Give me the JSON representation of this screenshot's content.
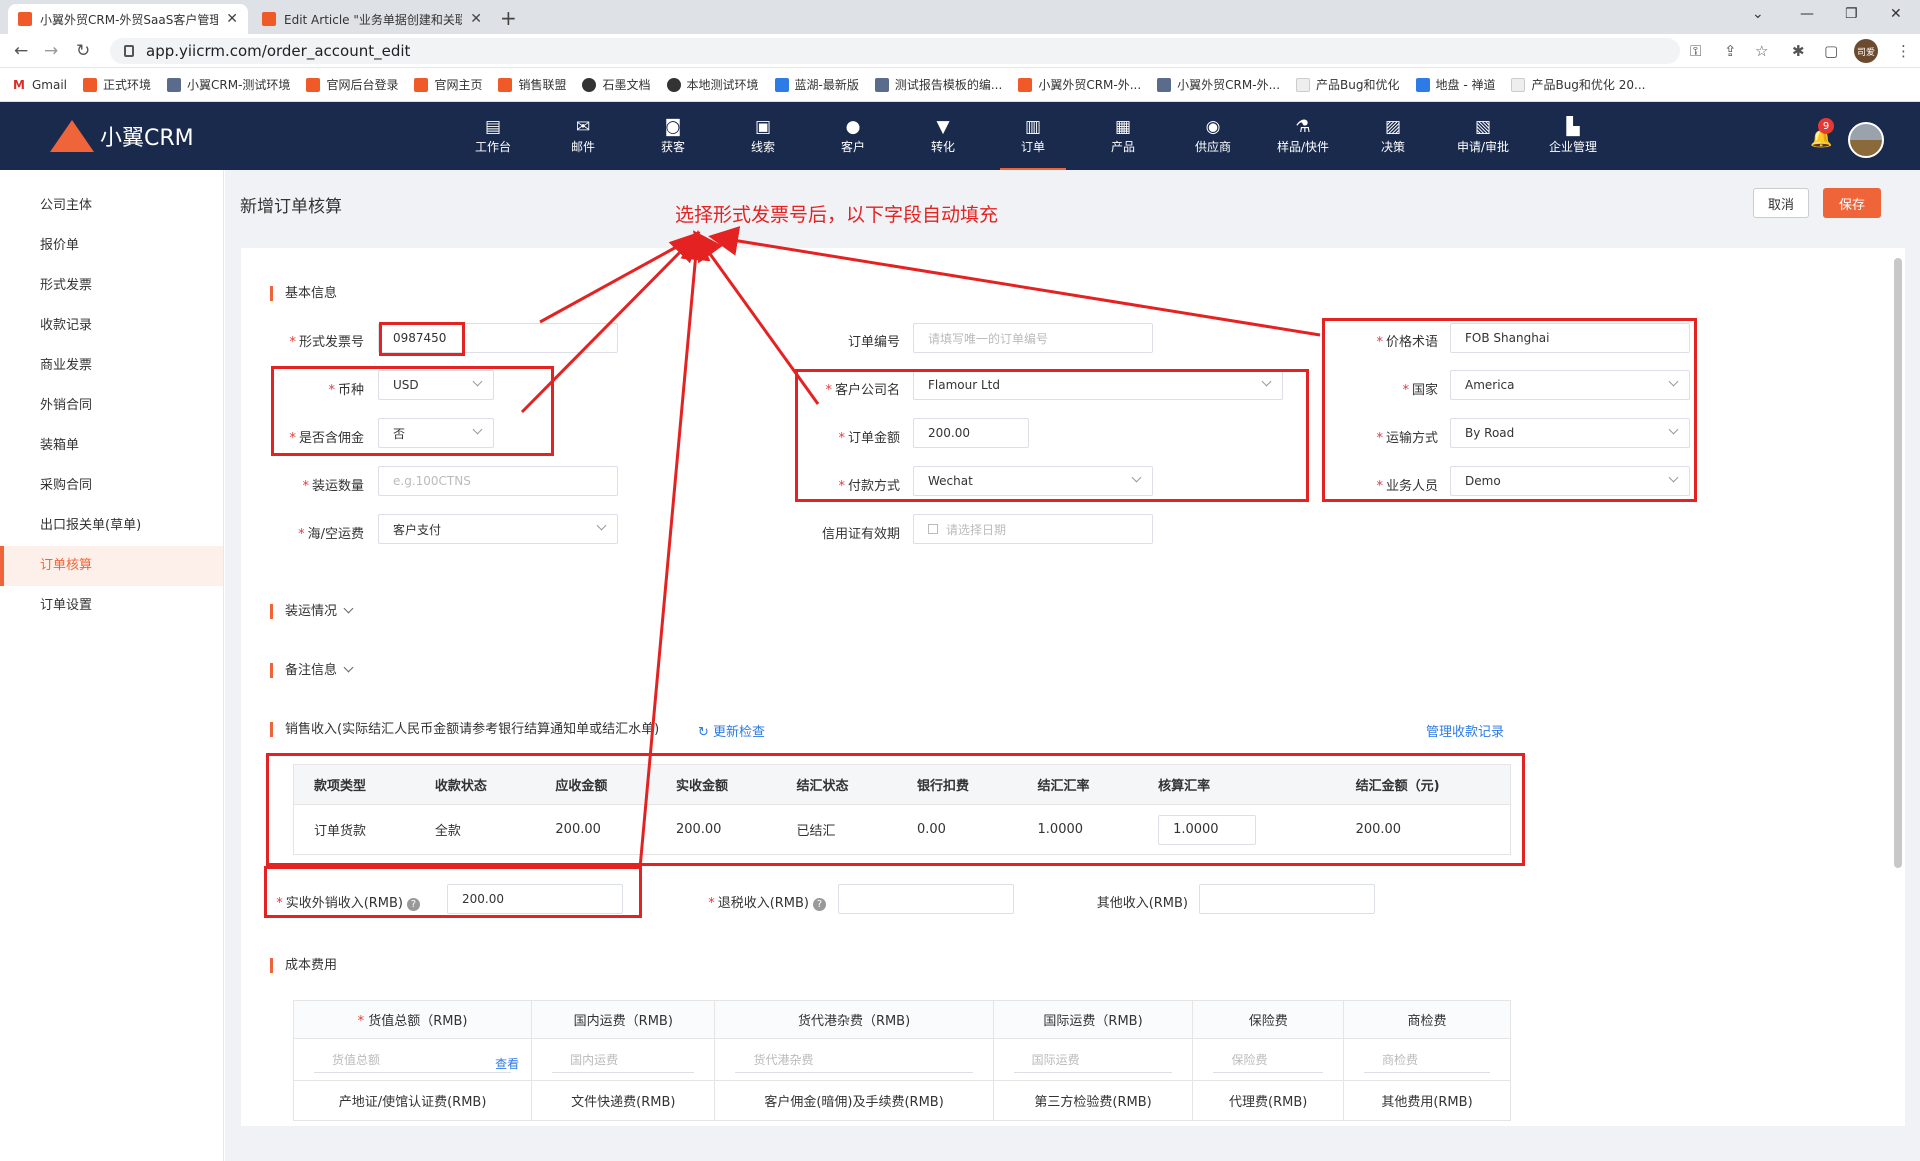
{
  "browser": {
    "tabs": [
      {
        "title": "小翼外贸CRM-外贸SaaS客户管理",
        "active": true
      },
      {
        "title": "Edit Article \"业务单据创建和关联",
        "active": false
      }
    ],
    "url": "app.yiicrm.com/order_account_edit",
    "profile_label": "司爱",
    "bookmarks": [
      "Gmail",
      "正式环境",
      "小翼CRM-测试环境",
      "官网后台登录",
      "官网主页",
      "销售联盟",
      "石墨文档",
      "本地测试环境",
      "蓝湖-最新版",
      "测试报告模板的编...",
      "小翼外贸CRM-外...",
      "小翼外贸CRM-外...",
      "产品Bug和优化",
      "地盘 - 禅道",
      "产品Bug和优化 20..."
    ]
  },
  "app": {
    "logo_text": "小翼CRM",
    "nav": [
      {
        "label": "工作台",
        "icon": "workbench-icon",
        "glyph": "▤"
      },
      {
        "label": "邮件",
        "icon": "mail-icon",
        "glyph": "✉"
      },
      {
        "label": "获客",
        "icon": "acquire-icon",
        "glyph": "◙"
      },
      {
        "label": "线索",
        "icon": "lead-icon",
        "glyph": "▣"
      },
      {
        "label": "客户",
        "icon": "customer-icon",
        "glyph": "●"
      },
      {
        "label": "转化",
        "icon": "funnel-icon",
        "glyph": "▼"
      },
      {
        "label": "订单",
        "icon": "order-icon",
        "glyph": "▥"
      },
      {
        "label": "产品",
        "icon": "product-icon",
        "glyph": "▦"
      },
      {
        "label": "供应商",
        "icon": "supplier-icon",
        "glyph": "◉"
      },
      {
        "label": "样品/快件",
        "icon": "flask-icon",
        "glyph": "⚗"
      },
      {
        "label": "决策",
        "icon": "chart-icon",
        "glyph": "▨"
      },
      {
        "label": "申请/审批",
        "icon": "approval-icon",
        "glyph": "▧"
      },
      {
        "label": "企业管理",
        "icon": "building-icon",
        "glyph": "▙"
      }
    ],
    "active_nav": "订单",
    "notification_count": "9"
  },
  "sidebar": [
    "公司主体",
    "报价单",
    "形式发票",
    "收款记录",
    "商业发票",
    "外销合同",
    "装箱单",
    "采购合同",
    "出口报关单(草单)",
    "订单核算",
    "订单设置"
  ],
  "page": {
    "title": "新增订单核算",
    "cancel": "取消",
    "save": "保存",
    "annotation": "选择形式发票号后，以下字段自动填充"
  },
  "basic": {
    "section": "基本信息",
    "proforma_label": "形式发票号",
    "proforma_value": "0987450",
    "currency_label": "币种",
    "currency_value": "USD",
    "commission_label": "是否含佣金",
    "commission_value": "否",
    "qty_label": "装运数量",
    "qty_placeholder": "e.g.100CTNS",
    "freight_label": "海/空运费",
    "freight_value": "客户支付",
    "orderno_label": "订单编号",
    "orderno_placeholder": "请填写唯一的订单编号",
    "company_label": "客户公司名",
    "company_value": "Flamour Ltd",
    "amount_label": "订单金额",
    "amount_value": "200.00",
    "payment_label": "付款方式",
    "payment_value": "Wechat",
    "lc_label": "信用证有效期",
    "lc_placeholder": "请选择日期",
    "terms_label": "价格术语",
    "terms_value": "FOB Shanghai",
    "country_label": "国家",
    "country_value": "America",
    "transport_label": "运输方式",
    "transport_value": "By Road",
    "sales_label": "业务人员",
    "sales_value": "Demo"
  },
  "shipping_section": "装运情况",
  "remark_section": "备注信息",
  "sales": {
    "section": "销售收入(实际结汇人民币金额请参考银行结算通知单或结汇水单)",
    "refresh": "更新检查",
    "manage": "管理收款记录",
    "headers": [
      "款项类型",
      "收款状态",
      "应收金额",
      "实收金额",
      "结汇状态",
      "银行扣费",
      "结汇汇率",
      "核算汇率",
      "结汇金额（元)"
    ],
    "row": [
      "订单货款",
      "全款",
      "200.00",
      "200.00",
      "已结汇",
      "0.00",
      "1.0000",
      "1.0000",
      "200.00"
    ],
    "actual_label": "实收外销收入(RMB)",
    "actual_value": "200.00",
    "tax_label": "退税收入(RMB)",
    "other_label": "其他收入(RMB)"
  },
  "cost": {
    "section": "成本费用",
    "headers1": [
      "货值总额（RMB)",
      "国内运费（RMB)",
      "货代港杂费（RMB)",
      "国际运费（RMB)",
      "保险费",
      "商检费"
    ],
    "placeholders": [
      "货值总额",
      "国内运费",
      "货代港杂费",
      "国际运费",
      "保险费",
      "商检费"
    ],
    "view": "查看",
    "headers2": [
      "产地证/使馆认证费(RMB)",
      "文件快递费(RMB)",
      "客户佣金(暗佣)及手续费(RMB)",
      "第三方检验费(RMB)",
      "代理费(RMB)",
      "其他费用(RMB)"
    ]
  }
}
